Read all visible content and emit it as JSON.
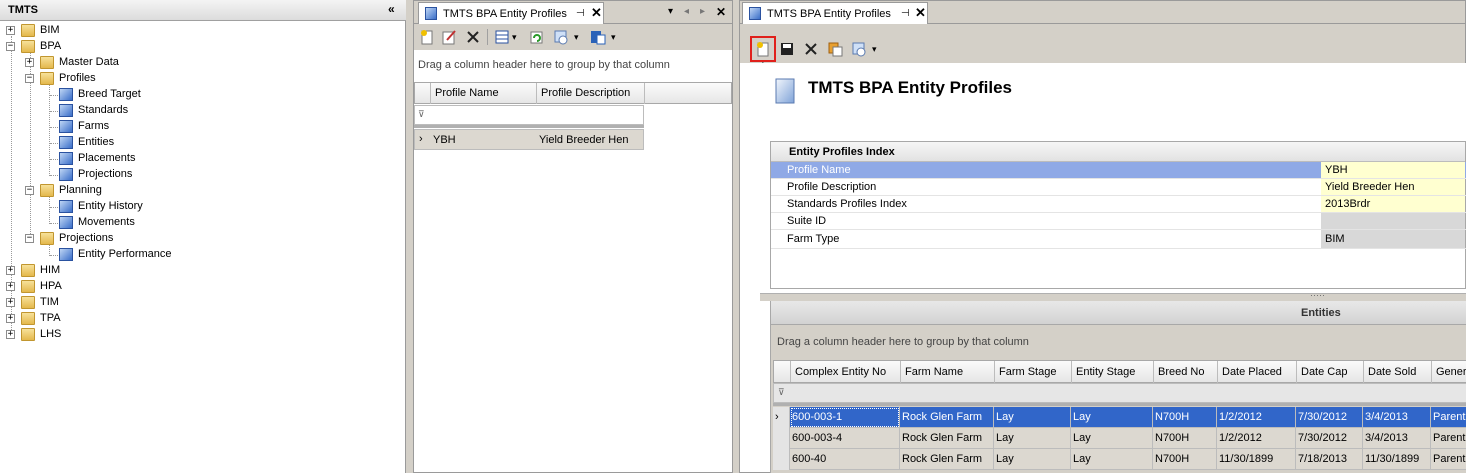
{
  "tree": {
    "title": "TMTS",
    "collapse_glyph": "«",
    "nodes": [
      {
        "label": "BIM",
        "type": "folder",
        "expander": "+"
      },
      {
        "label": "BPA",
        "type": "folder",
        "expander": "−"
      },
      {
        "label": "Master Data",
        "type": "folder",
        "expander": "+"
      },
      {
        "label": "Profiles",
        "type": "folder",
        "expander": "−"
      },
      {
        "label": "Breed Target",
        "type": "doc"
      },
      {
        "label": "Standards",
        "type": "doc"
      },
      {
        "label": "Farms",
        "type": "doc"
      },
      {
        "label": "Entities",
        "type": "doc"
      },
      {
        "label": "Placements",
        "type": "doc"
      },
      {
        "label": "Projections",
        "type": "doc"
      },
      {
        "label": "Planning",
        "type": "folder",
        "expander": "−"
      },
      {
        "label": "Entity History",
        "type": "doc"
      },
      {
        "label": "Movements",
        "type": "doc"
      },
      {
        "label": "Projections",
        "type": "folder",
        "expander": "−"
      },
      {
        "label": "Entity Performance",
        "type": "doc"
      },
      {
        "label": "HIM",
        "type": "folder",
        "expander": "+"
      },
      {
        "label": "HPA",
        "type": "folder",
        "expander": "+"
      },
      {
        "label": "TIM",
        "type": "folder",
        "expander": "+"
      },
      {
        "label": "TPA",
        "type": "folder",
        "expander": "+"
      },
      {
        "label": "LHS",
        "type": "folder",
        "expander": "+"
      }
    ]
  },
  "mid": {
    "tab_label": "TMTS BPA Entity Profiles",
    "pin_glyph": "⊣",
    "close_glyph": "✕",
    "nav": {
      "dropdown": "▾",
      "prev": "◂",
      "next": "▸",
      "close": "✕"
    },
    "group_hint": "Drag a column header here to group by that column",
    "columns": [
      "Profile Name",
      "Profile Description"
    ],
    "rows": [
      {
        "name": "YBH",
        "description": "Yield Breeder Hen"
      }
    ]
  },
  "right": {
    "tab_label": "TMTS BPA Entity Profiles",
    "pin_glyph": "⊣",
    "close_glyph": "✕",
    "title": "TMTS BPA Entity Profiles",
    "index": {
      "header": "Entity Profiles Index",
      "rows": [
        {
          "name": "Profile Name",
          "value": "YBH"
        },
        {
          "name": "Profile Description",
          "value": "Yield Breeder Hen"
        },
        {
          "name": "Standards Profiles Index",
          "value": "2013Brdr"
        },
        {
          "name": "Suite ID",
          "value": ""
        },
        {
          "name": "Farm Type",
          "value": "BIM"
        }
      ]
    },
    "splitter_grip": "·····",
    "entities": {
      "title": "Entities",
      "group_hint": "Drag a column header here to group by that column",
      "columns": [
        "Complex Entity No",
        "Farm Name",
        "Farm Stage",
        "Entity Stage",
        "Breed No",
        "Date Placed",
        "Date Cap",
        "Date Sold",
        "Genera"
      ],
      "rows": [
        [
          "600-003-1",
          "Rock Glen Farm",
          "Lay",
          "Lay",
          "N700H",
          "1/2/2012",
          "7/30/2012",
          "3/4/2013",
          "Parent"
        ],
        [
          "600-003-4",
          "Rock Glen Farm",
          "Lay",
          "Lay",
          "N700H",
          "1/2/2012",
          "7/30/2012",
          "3/4/2013",
          "Parent"
        ],
        [
          "600-40",
          "Rock Glen Farm",
          "Lay",
          "Lay",
          "N700H",
          "11/30/1899",
          "7/18/2013",
          "11/30/1899",
          "Parent"
        ]
      ]
    }
  },
  "colors": {
    "selection": "#3166c9",
    "property_selected": "#8fa9e6",
    "value_yellow": "#ffffd0",
    "highlight_red": "#e0201b"
  },
  "glyphs": {
    "row_indicator": "›",
    "filter": "⊽",
    "dropdown": "▾"
  }
}
